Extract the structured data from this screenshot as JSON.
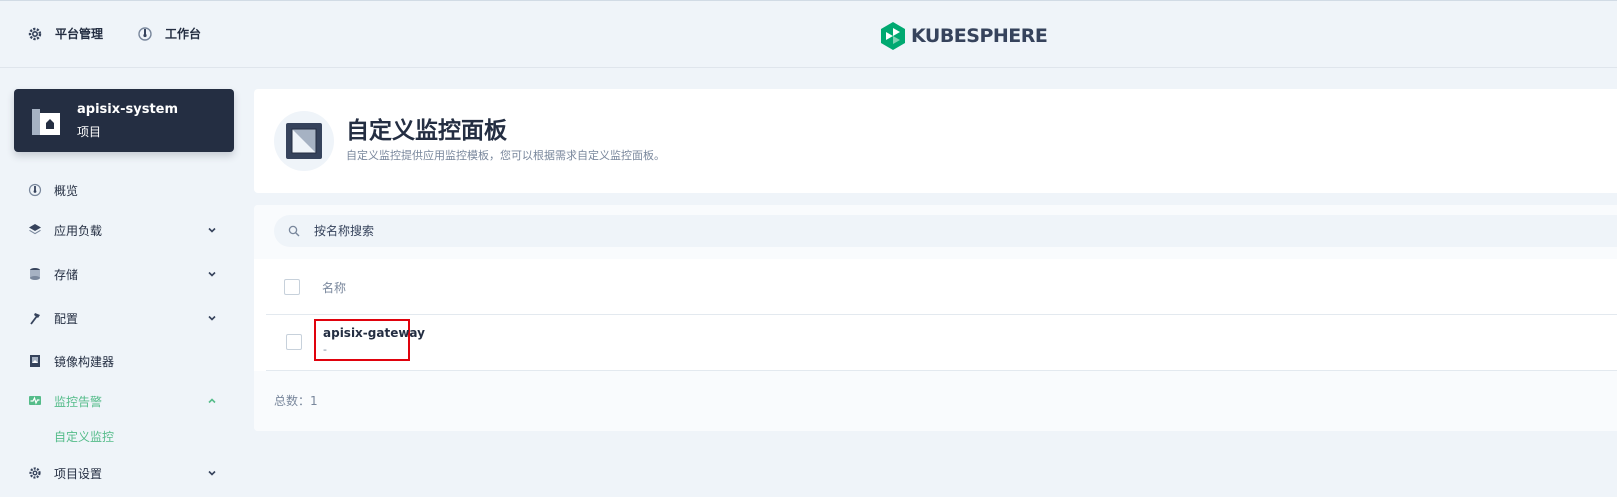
{
  "topbar": {
    "platform_label": "平台管理",
    "workbench_label": "工作台",
    "brand": "KUBESPHERE",
    "brand_color": "#00A971"
  },
  "project": {
    "name": "apisix-system",
    "type": "项目"
  },
  "sidebar": {
    "items": [
      {
        "label": "概览",
        "icon": "dashboard-icon"
      },
      {
        "label": "应用负载",
        "icon": "layers-icon"
      },
      {
        "label": "存储",
        "icon": "database-icon"
      },
      {
        "label": "配置",
        "icon": "hammer-icon"
      },
      {
        "label": "镜像构建器",
        "icon": "image-builder-icon"
      },
      {
        "label": "监控告警",
        "icon": "monitor-icon"
      },
      {
        "label": "项目设置",
        "icon": "gear-icon"
      }
    ],
    "sub_active": "自定义监控",
    "active_color": "#55BC8A"
  },
  "header": {
    "title": "自定义监控面板",
    "description": "自定义监控提供应用监控模板，您可以根据需求自定义监控面板。"
  },
  "search": {
    "placeholder": "按名称搜索"
  },
  "table": {
    "columns": [
      "名称"
    ],
    "rows": [
      {
        "name": "apisix-gateway",
        "desc": "-"
      }
    ],
    "total": "总数：1"
  }
}
